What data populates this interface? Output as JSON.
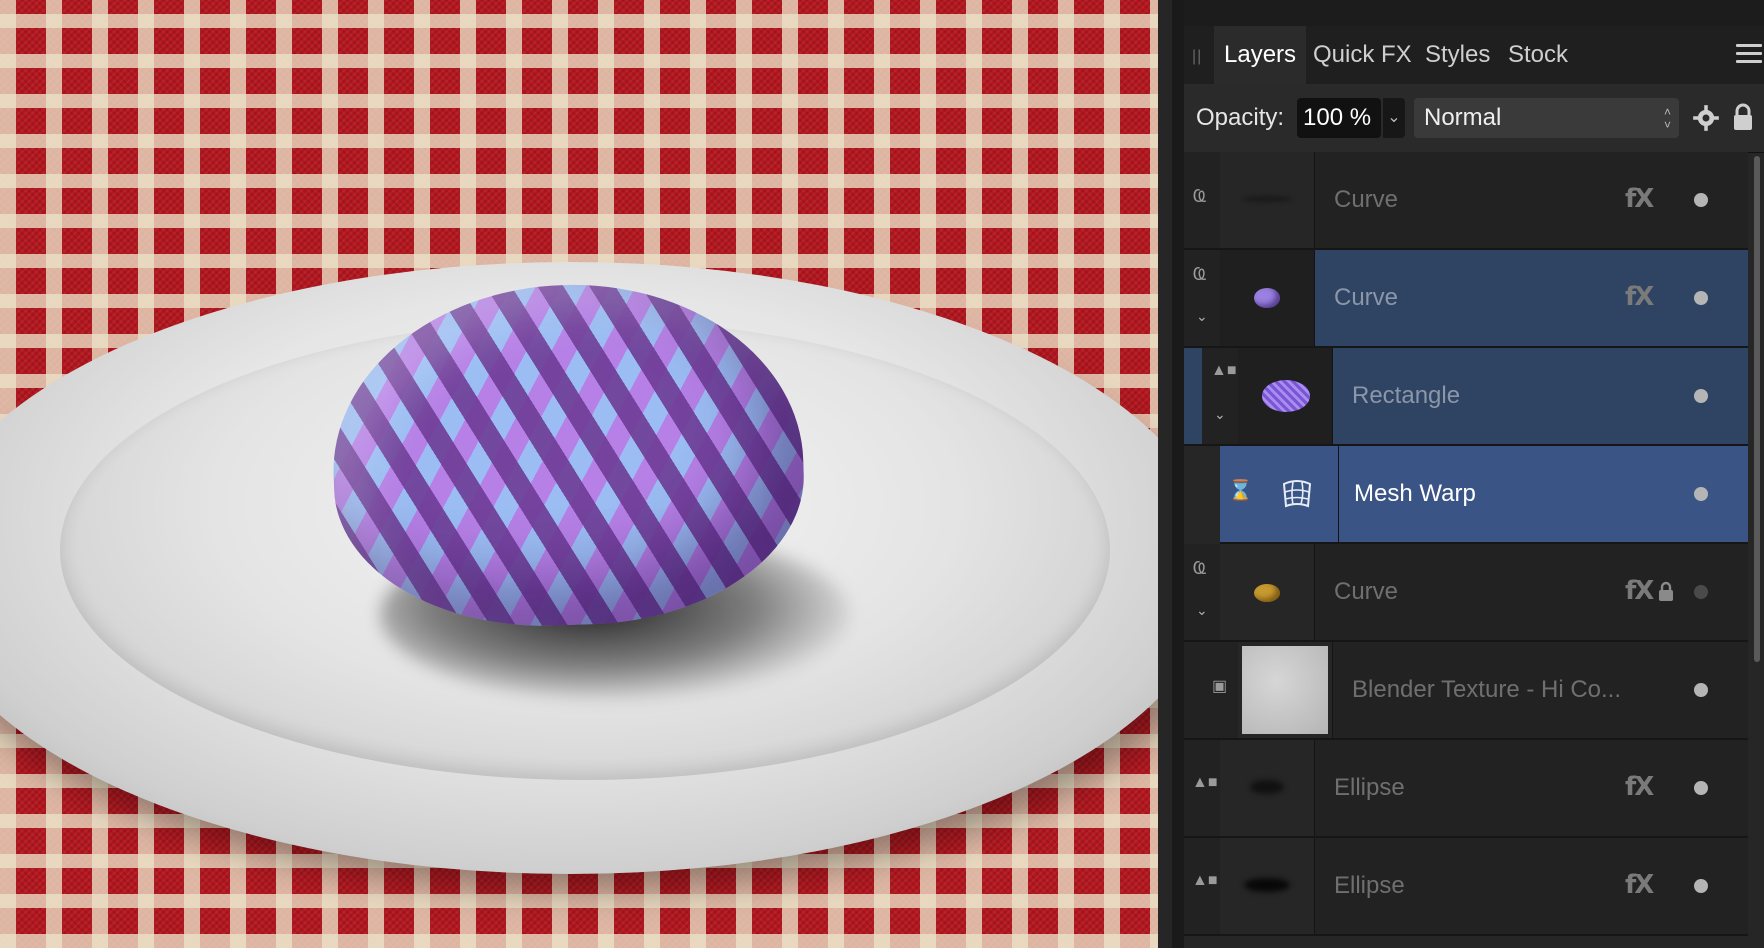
{
  "panel": {
    "tabs": [
      {
        "label": "Layers",
        "active": true
      },
      {
        "label": "Quick FX",
        "active": false
      },
      {
        "label": "Styles",
        "active": false
      },
      {
        "label": "Stock",
        "active": false
      }
    ],
    "opacity_label": "Opacity:",
    "opacity_value": "100 %",
    "blend_mode": "Normal"
  },
  "layers": [
    {
      "name": "Curve",
      "fx": "fX",
      "thumb": "dark-blur",
      "state": "normal",
      "icon": "link-icon"
    },
    {
      "name": "Curve",
      "fx": "fX",
      "thumb": "purple-egg",
      "state": "selected",
      "icon": "link-icon"
    },
    {
      "name": "Rectangle",
      "fx": "",
      "thumb": "purple-pattern",
      "state": "selected",
      "icon": "shapes-icon"
    },
    {
      "name": "Mesh Warp",
      "fx": "",
      "thumb": "mesh-icon",
      "state": "active",
      "icon": "hourglass-icon"
    },
    {
      "name": "Curve",
      "fx": "fX",
      "thumb": "gold-egg",
      "state": "normal",
      "icon": "link-icon",
      "locked": true
    },
    {
      "name": "Blender Texture - Hi Co...",
      "fx": "",
      "thumb": "grey-texture",
      "state": "normal",
      "icon": "image-icon"
    },
    {
      "name": "Ellipse",
      "fx": "fX",
      "thumb": "dark-blur",
      "state": "normal",
      "icon": "shapes-icon"
    },
    {
      "name": "Ellipse",
      "fx": "fX",
      "thumb": "dark-blur",
      "state": "normal",
      "icon": "shapes-icon"
    }
  ],
  "colors": {
    "selected_row": "#2f4363",
    "active_row": "#3a5585",
    "panel_bg": "#262626"
  }
}
